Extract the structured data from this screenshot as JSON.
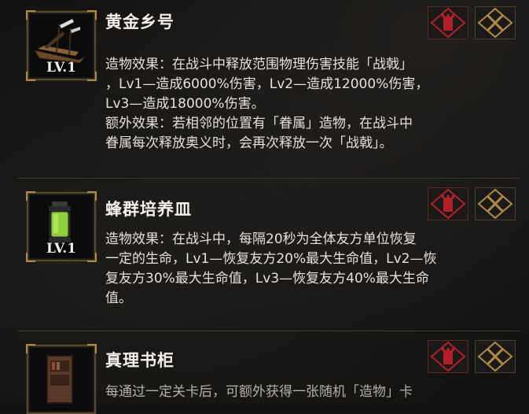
{
  "items": [
    {
      "title": "黄金乡号",
      "level": "LV.1",
      "icon": "ship-icon",
      "lines": [
        "造物效果：在战斗中释放范围物理伤害技能「战戟」",
        "，Lv1—造成6000%伤害，Lv2—造成12000%伤害，",
        "Lv3—造成18000%伤害。",
        "额外效果：若相邻的位置有「眷属」造物，在战斗中",
        "眷属每次释放奥义时，会再次释放一次「战戟」。"
      ]
    },
    {
      "title": "蜂群培养皿",
      "level": "LV.1",
      "icon": "lantern-jar-icon",
      "lines": [
        "造物效果：在战斗中，每隔20秒为全体友方单位恢复",
        "一定的生命，Lv1—恢复友方20%最大生命值，Lv2—恢",
        "复友方30%最大生命值，Lv3—恢复友方40%最大生命",
        "值。"
      ]
    },
    {
      "title": "真理书柜",
      "level": "",
      "icon": "bookcase-icon",
      "lines": [
        "每通过一定关卡后，可额外获得一张随机「造物」卡"
      ]
    }
  ],
  "colors": {
    "badge_red": "#b3202a",
    "badge_gold": "#b08a45"
  }
}
